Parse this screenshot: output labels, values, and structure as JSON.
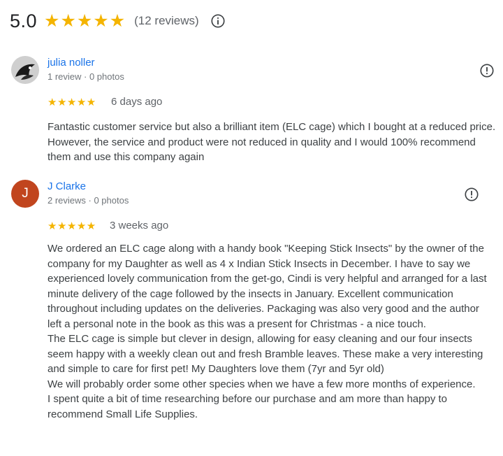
{
  "summary": {
    "rating": "5.0",
    "stars": "★★★★★",
    "count": "(12 reviews)",
    "info_icon": "info-circle-icon"
  },
  "colors": {
    "star": "#f4b400",
    "author_link": "#1a73e8",
    "avatar_j": "#c1451e",
    "text": "#3c4043",
    "meta": "#70757a"
  },
  "reviews": [
    {
      "author": "julia noller",
      "meta": "1 review · 0 photos",
      "avatar_icon": "profile-photo",
      "stars": "★★★★★",
      "rating": 5,
      "date": "6 days ago",
      "flag_icon": "report-flag-icon",
      "paragraphs": [
        "Fantastic customer service but also a brilliant item (ELC cage) which I bought at a reduced price. However, the service and product were not reduced in quality and I would 100% recommend them and use this company again"
      ]
    },
    {
      "author": "J Clarke",
      "meta": "2 reviews · 0 photos",
      "avatar_letter": "J",
      "stars": "★★★★★",
      "rating": 5,
      "date": "3 weeks ago",
      "flag_icon": "report-flag-icon",
      "paragraphs": [
        "We ordered an ELC cage along with a handy book \"Keeping Stick Insects\" by the owner of the company for my Daughter as well as 4 x Indian Stick Insects in December. I have to say we experienced lovely communication from the get-go, Cindi is very helpful and arranged for a last minute delivery of the cage followed by the insects in January. Excellent communication throughout including updates on the deliveries. Packaging was also very good and the author left a personal note in the book as this was a present for Christmas - a nice touch.",
        "The ELC cage is simple but clever in design, allowing for easy cleaning and our four insects seem happy with a weekly clean out and fresh Bramble leaves. These make a very interesting and simple to care for first pet! My Daughters love them (7yr and 5yr old)",
        "We will probably order some other species when we have a few more months of experience.",
        "I spent quite a bit of time researching before our purchase and am more than happy to recommend Small Life Supplies."
      ]
    }
  ]
}
